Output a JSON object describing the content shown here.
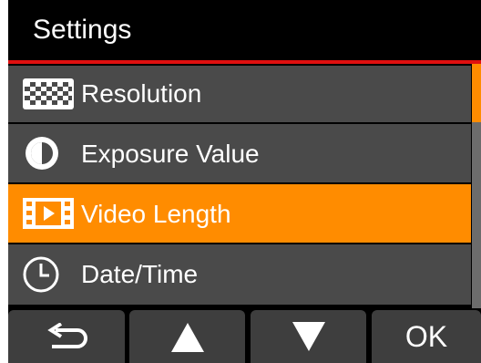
{
  "title_bar": {
    "title": "Settings"
  },
  "menu": {
    "items": [
      {
        "label": "Resolution",
        "icon": "resolution-icon",
        "selected": false
      },
      {
        "label": "Exposure Value",
        "icon": "exposure-icon",
        "selected": false
      },
      {
        "label": "Video Length",
        "icon": "film-icon",
        "selected": true
      },
      {
        "label": "Date/Time",
        "icon": "clock-icon",
        "selected": false
      }
    ]
  },
  "scrollbar": {
    "position": 0
  },
  "bottom_bar": {
    "buttons": [
      {
        "name": "back-button",
        "icon": "return-arrow-icon"
      },
      {
        "name": "up-button",
        "icon": "triangle-up-icon"
      },
      {
        "name": "down-button",
        "icon": "triangle-down-icon"
      },
      {
        "name": "ok-button",
        "label": "OK"
      }
    ]
  },
  "colors": {
    "accent": "#ff8c00",
    "title_rule": "#e01010",
    "item_bg": "#4a4a4a",
    "button_bg": "#3e3e3e"
  }
}
